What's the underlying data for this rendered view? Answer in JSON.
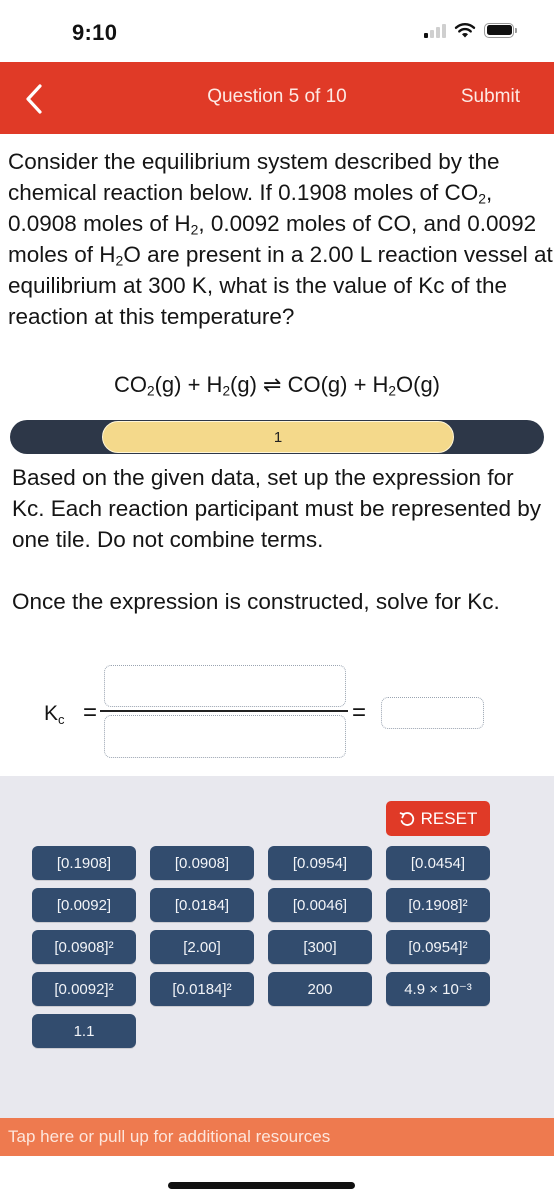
{
  "status_bar": {
    "time": "9:10",
    "icons": [
      "signal-icon",
      "wifi-icon",
      "battery-icon"
    ]
  },
  "header": {
    "back_icon": "chevron-left-icon",
    "title": "Question 5 of 10",
    "submit_label": "Submit"
  },
  "question": {
    "text_parts": [
      "Consider the equilibrium system described by the chemical reaction below. If 0.1908 moles of CO",
      "2",
      ", 0.0908 moles of H",
      "2",
      ", 0.0092 moles of CO, and 0.0092 moles of H",
      "2",
      "O are present in a 2.00 L reaction vessel at equilibrium at 300 K, what is the value of Kc of the reaction at this temperature?"
    ]
  },
  "equation": {
    "parts": [
      "CO",
      "2",
      "(g) + H",
      "2",
      "(g) ",
      "⇌",
      " CO(g) + H",
      "2",
      "O(g)"
    ]
  },
  "step_bar": {
    "current_step": "1"
  },
  "instructions": {
    "paragraph1": "Based on the given data, set up the expression for Kc. Each reaction participant must be represented by one tile. Do not combine terms.",
    "paragraph2": "Once the expression is constructed, solve for Kc."
  },
  "expression": {
    "kc_main": "K",
    "kc_sub": "c",
    "equals": "="
  },
  "tile_area": {
    "reset_label": "RESET",
    "reset_icon": "undo-icon",
    "tiles": [
      "[0.1908]",
      "[0.0908]",
      "[0.0954]",
      "[0.0454]",
      "[0.0092]",
      "[0.0184]",
      "[0.0046]",
      "[0.1908]²",
      "[0.0908]²",
      "[2.00]",
      "[300]",
      "[0.0954]²",
      "[0.0092]²",
      "[0.0184]²",
      "200",
      "4.9 × 10⁻³",
      "1.1"
    ]
  },
  "resources_bar": {
    "label": "Tap here or pull up for additional resources"
  },
  "colors": {
    "header": "#e03a27",
    "tile": "#324c6e",
    "step_bar": "#2d3748",
    "step_pill": "#f4d98b",
    "resources": "#ee7a4f",
    "tile_area_bg": "#e8e8ee"
  }
}
